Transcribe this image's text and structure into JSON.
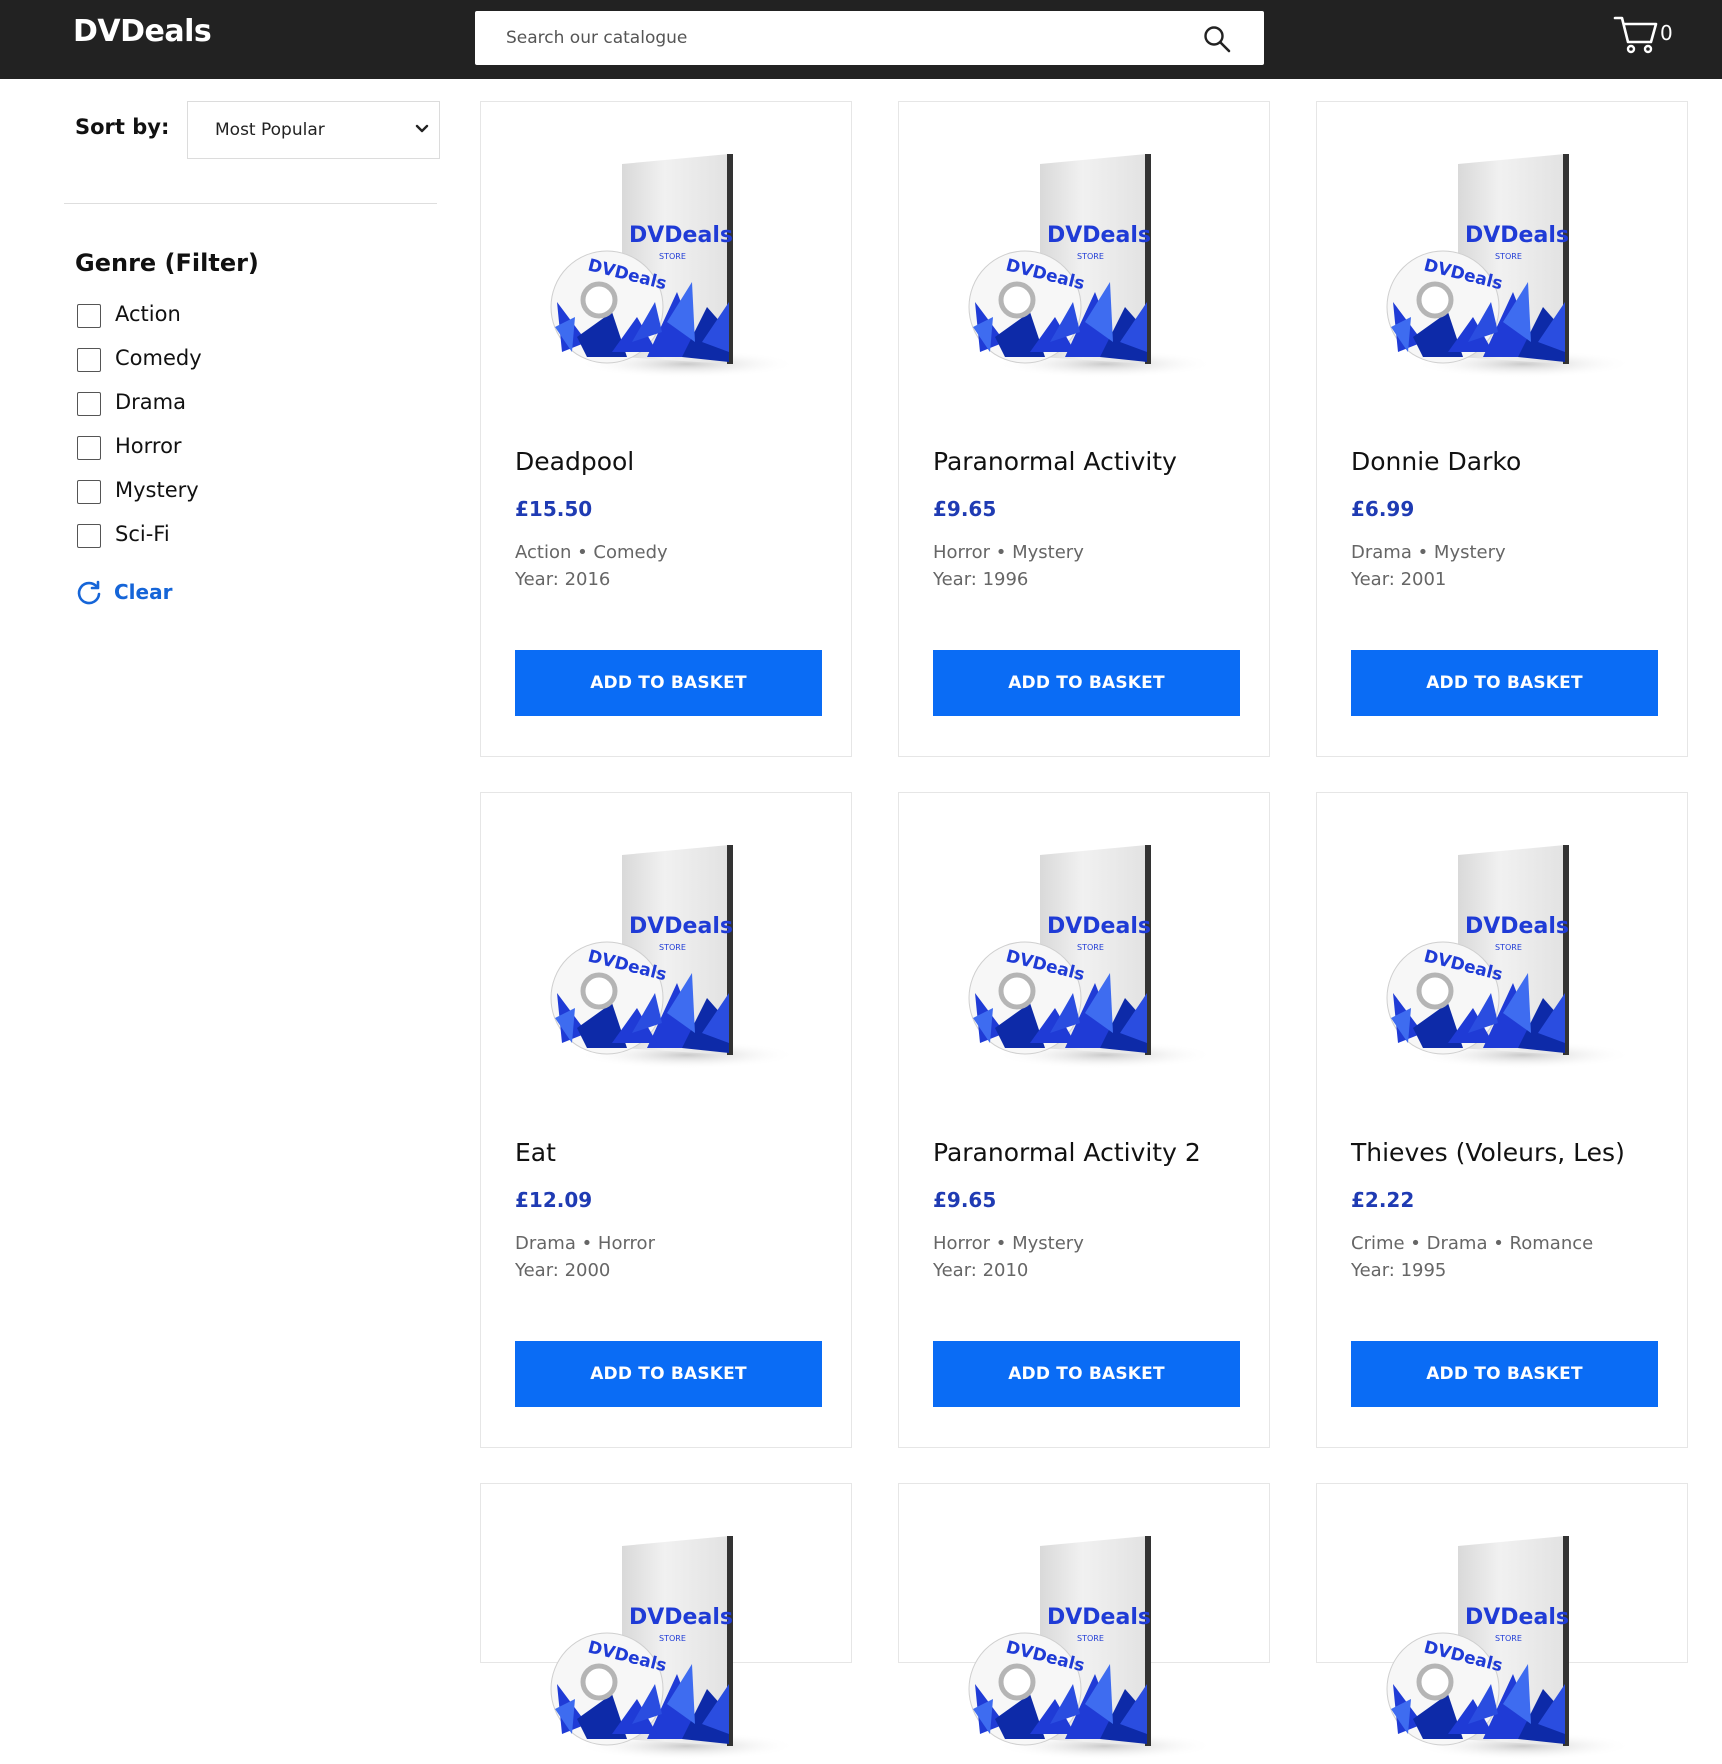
{
  "header": {
    "logo": "DVDeals",
    "search_placeholder": "Search our catalogue",
    "cart_count": "0"
  },
  "sidebar": {
    "sort_label": "Sort by:",
    "sort_selected": "Most Popular",
    "genre_title": "Genre (Filter)",
    "genres": [
      "Action",
      "Comedy",
      "Drama",
      "Horror",
      "Mystery",
      "Sci-Fi"
    ],
    "clear_label": "Clear"
  },
  "products": [
    {
      "title": "Deadpool",
      "price": "£15.50",
      "genres": "Action • Comedy",
      "year": "Year: 2016",
      "button": "ADD TO BASKET"
    },
    {
      "title": "Paranormal Activity",
      "price": "£9.65",
      "genres": "Horror • Mystery",
      "year": "Year: 1996",
      "button": "ADD TO BASKET"
    },
    {
      "title": "Donnie Darko",
      "price": "£6.99",
      "genres": "Drama • Mystery",
      "year": "Year: 2001",
      "button": "ADD TO BASKET"
    },
    {
      "title": "Eat",
      "price": "£12.09",
      "genres": "Drama • Horror",
      "year": "Year: 2000",
      "button": "ADD TO BASKET"
    },
    {
      "title": "Paranormal Activity 2",
      "price": "£9.65",
      "genres": "Horror • Mystery",
      "year": "Year: 2010",
      "button": "ADD TO BASKET"
    },
    {
      "title": "Thieves (Voleurs, Les)",
      "price": "£2.22",
      "genres": "Crime • Drama • Romance",
      "year": "Year: 1995",
      "button": "ADD TO BASKET"
    },
    {
      "title": "",
      "price": "",
      "genres": "",
      "year": "",
      "button": ""
    },
    {
      "title": "",
      "price": "",
      "genres": "",
      "year": "",
      "button": ""
    },
    {
      "title": "",
      "price": "",
      "genres": "",
      "year": "",
      "button": ""
    }
  ],
  "dvd_art": {
    "brand": "DVDeals",
    "store": "STORE"
  },
  "colors": {
    "header_bg": "#222222",
    "accent_button": "#0a6cf5",
    "price": "#1f3bb3",
    "clear_link": "#1565d8"
  }
}
